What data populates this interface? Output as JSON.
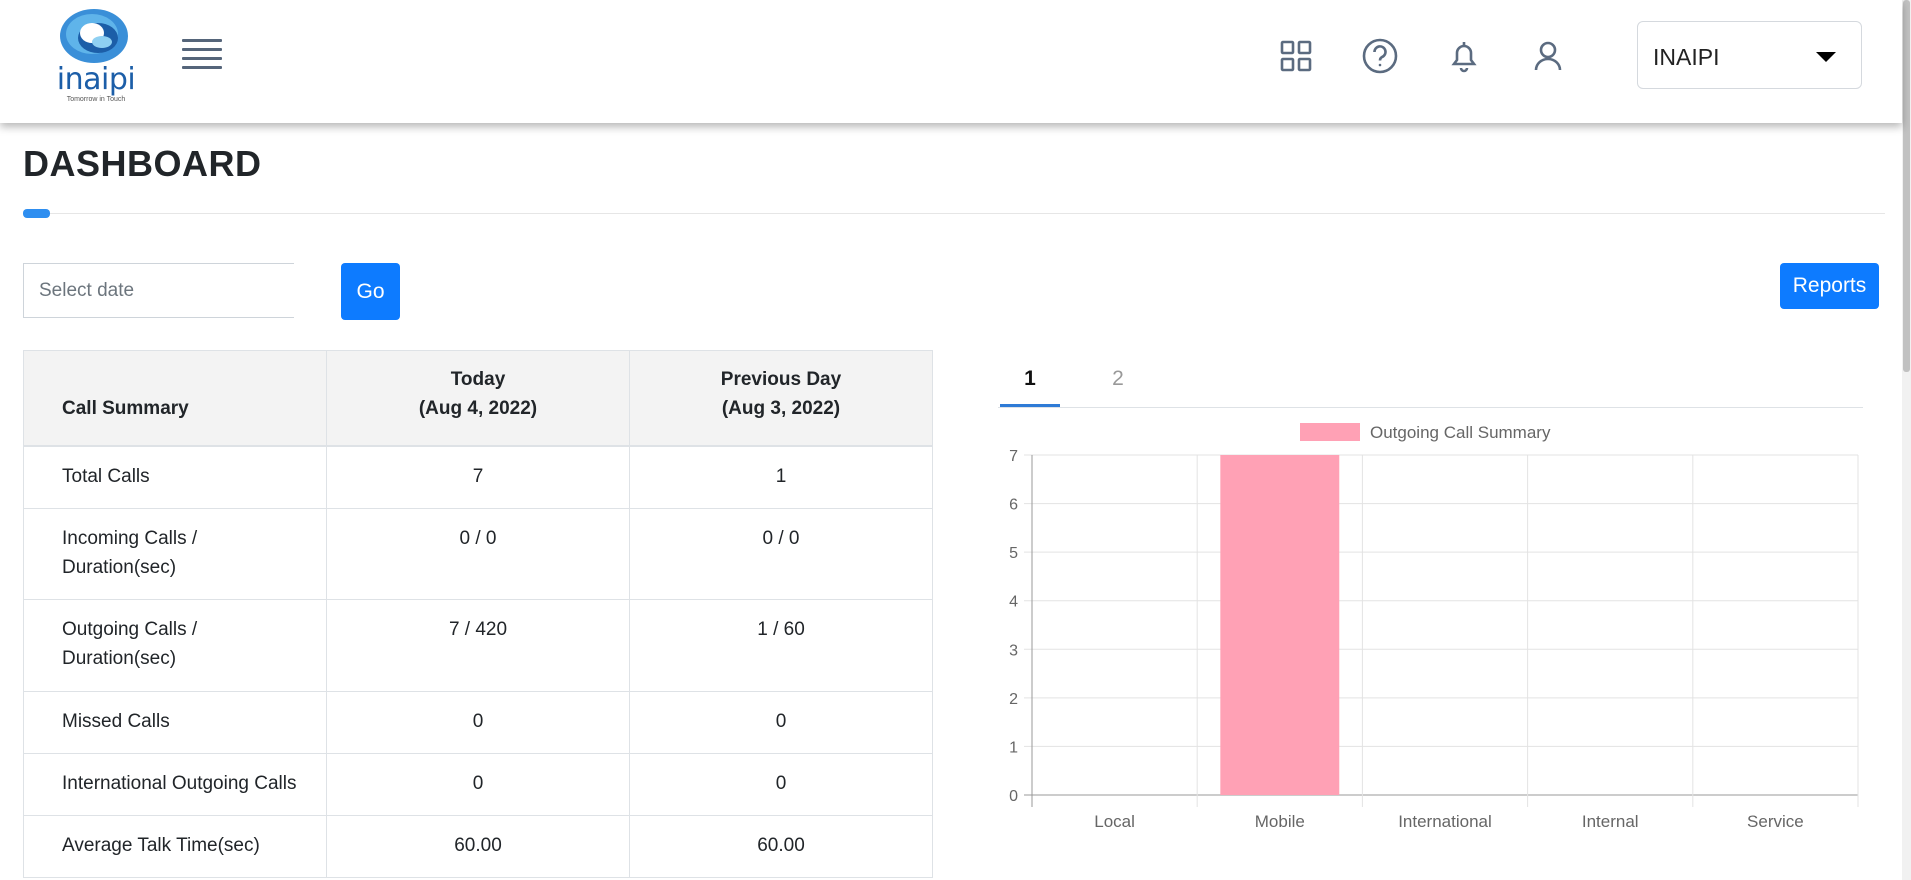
{
  "header": {
    "logo_text": "inaipi",
    "logo_tagline": "Tomorrow in Touch",
    "org_selector": "INAIPI",
    "icons": [
      "apps-grid-icon",
      "help-icon",
      "bell-icon",
      "user-icon",
      "menu-icon"
    ]
  },
  "page": {
    "title": "DASHBOARD"
  },
  "filters": {
    "date_placeholder": "Select date",
    "go_label": "Go",
    "reports_label": "Reports"
  },
  "summary_table": {
    "header": {
      "label": "Call Summary",
      "today_line1": "Today",
      "today_line2": "(Aug 4, 2022)",
      "prev_line1": "Previous Day",
      "prev_line2": "(Aug 3, 2022)"
    },
    "rows": [
      {
        "label": "Total Calls",
        "today": "7",
        "previous": "1"
      },
      {
        "label": "Incoming Calls / Duration(sec)",
        "today": "0 / 0",
        "previous": "0 / 0"
      },
      {
        "label": "Outgoing Calls / Duration(sec)",
        "today": "7 / 420",
        "previous": "1 / 60"
      },
      {
        "label": "Missed Calls",
        "today": "0",
        "previous": "0"
      },
      {
        "label": "International Outgoing Calls",
        "today": "0",
        "previous": "0"
      },
      {
        "label": "Average Talk Time(sec)",
        "today": "60.00",
        "previous": "60.00"
      }
    ]
  },
  "chart_tabs": [
    {
      "label": "1",
      "active": true
    },
    {
      "label": "2",
      "active": false
    }
  ],
  "colors": {
    "accent": "#0d7bff",
    "bar": "#ffa1b5",
    "bar_border": "#ff6384"
  },
  "chart_data": {
    "type": "bar",
    "categories": [
      "Local",
      "Mobile",
      "International",
      "Internal",
      "Service"
    ],
    "series": [
      {
        "name": "Outgoing Call Summary",
        "values": [
          0,
          7,
          0,
          0,
          0
        ]
      }
    ],
    "ylim": [
      0,
      7
    ],
    "yticks": [
      0,
      1,
      2,
      3,
      4,
      5,
      6,
      7
    ],
    "legend": "top",
    "grid": true
  }
}
